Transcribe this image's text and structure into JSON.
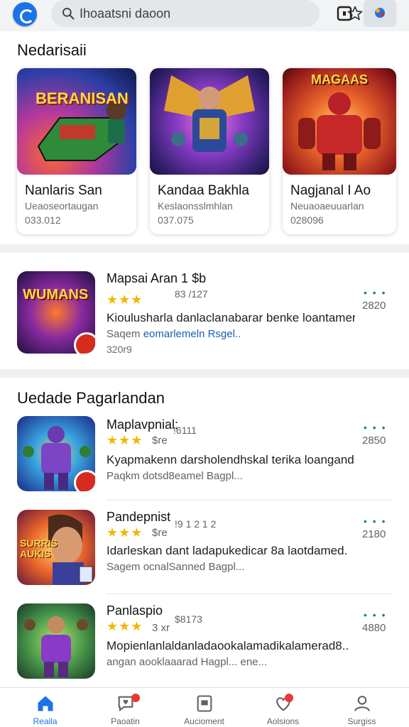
{
  "header": {
    "search_value": "Ihoaatsni daoon",
    "icons": [
      "app-logo",
      "search-icon",
      "star-icon",
      "grid-icon",
      "profile-icon"
    ]
  },
  "featured": {
    "title": "Nedarisaii",
    "cards": [
      {
        "title": "Nanlaris San",
        "subtitle": "Ueaoseortaugan",
        "number": "033.012",
        "art_text": "BERANISAN"
      },
      {
        "title": "Kandaa Bakhla",
        "subtitle": "Keslaonsslmhlan",
        "number": "037.075",
        "art_text": ""
      },
      {
        "title": "Nagjanal I  Ao",
        "subtitle": "Neuaoaeuuarlan",
        "number": "028096",
        "art_text": "MAGAAS"
      }
    ]
  },
  "spotlight": {
    "name": "Mapsai Aran 1 $b",
    "stars": "★★★",
    "code": "83 /127",
    "description": "Kioulusharla danlaclanabarar benke loantamerl",
    "meta_prefix": "Saqem ",
    "meta_link": "eomarlemeln Rsgel..",
    "footer": "320r9",
    "dots": "• • •",
    "count": "2820",
    "art_text": "WUMANS"
  },
  "updates": {
    "title": "Uedade Pagarlandan",
    "items": [
      {
        "name": "Maplavpnial:",
        "stars": "★★★",
        "price": "$re",
        "code": "!6111",
        "description": "Kyapmakenn darsholendhskal terika loangandi...",
        "meta": "Paqkm dotsd8eamel Bagpl...",
        "dots": "• • •",
        "count": "2850"
      },
      {
        "name": "Pandepnist",
        "stars": "★★★",
        "price": "$re",
        "code": "!9 1 2 1 2",
        "description": "Idarleskan dant ladapukedicar 8a laotdamed.",
        "meta": "Sagem ocnalSanned Bagpl...",
        "dots": "• • •",
        "count": "2180"
      },
      {
        "name": "Panlaspio",
        "stars": "★★★",
        "price": "3 xr",
        "code": "$8173",
        "description": "Mopienlanlaldanladaookalamadikalamerad8..",
        "meta": "angan aooklaaarad Hagpl... ene...",
        "dots": "• • •",
        "count": "4880"
      }
    ]
  },
  "bottom_nav": [
    {
      "label": "Reaila",
      "icon": "home-icon",
      "active": true
    },
    {
      "label": "Paoatin",
      "icon": "chat-heart-icon",
      "active": false
    },
    {
      "label": "Aucioment",
      "icon": "library-icon",
      "active": false
    },
    {
      "label": "Aolsions",
      "icon": "heart-icon",
      "active": false
    },
    {
      "label": "Surgiss",
      "icon": "person-icon",
      "active": false
    }
  ],
  "colors": {
    "accent": "#1a73e8",
    "star": "#f2b600",
    "green": "#1e8e3e",
    "badge": "#d62c20"
  }
}
